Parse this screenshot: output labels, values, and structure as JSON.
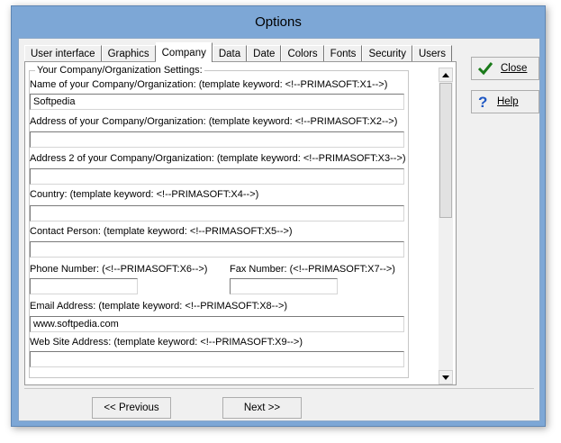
{
  "window": {
    "title": "Options"
  },
  "tabs": [
    {
      "label": "User interface"
    },
    {
      "label": "Graphics"
    },
    {
      "label": "Company",
      "active": true
    },
    {
      "label": "Data"
    },
    {
      "label": "Date"
    },
    {
      "label": "Colors"
    },
    {
      "label": "Fonts"
    },
    {
      "label": "Security"
    },
    {
      "label": "Users"
    }
  ],
  "group": {
    "legend": "Your Company/Organization Settings:"
  },
  "fields": {
    "name": {
      "label": "Name of your Company/Organization:   (template keyword: <!--PRIMASOFT:X1-->)",
      "value": "Softpedia"
    },
    "address": {
      "label": "Address of your Company/Organization:   (template keyword: <!--PRIMASOFT:X2-->)",
      "value": ""
    },
    "address2": {
      "label": "Address 2 of your Company/Organization:   (template keyword: <!--PRIMASOFT:X3-->)",
      "value": ""
    },
    "country": {
      "label": "Country:   (template keyword: <!--PRIMASOFT:X4-->)",
      "value": ""
    },
    "contact": {
      "label": "Contact Person:   (template keyword: <!--PRIMASOFT:X5-->)",
      "value": ""
    },
    "phone": {
      "label": "Phone Number:   (<!--PRIMASOFT:X6-->)",
      "value": ""
    },
    "fax": {
      "label": "Fax Number:   (<!--PRIMASOFT:X7-->)",
      "value": ""
    },
    "email": {
      "label": "Email Address:   (template keyword: <!--PRIMASOFT:X8-->)",
      "value": "www.softpedia.com"
    },
    "website": {
      "label": "Web Site Address:   (template keyword: <!--PRIMASOFT:X9-->)",
      "value": ""
    }
  },
  "buttons": {
    "close": {
      "label": "Close",
      "icon": "checkmark-icon"
    },
    "help": {
      "label": "Help",
      "icon": "question-icon"
    },
    "previous": {
      "label": "<< Previous"
    },
    "next": {
      "label": "Next >>"
    }
  },
  "colors": {
    "titlebar": "#7da7d6",
    "checkmark": "#1a7a1a",
    "help": "#1f58c4"
  }
}
